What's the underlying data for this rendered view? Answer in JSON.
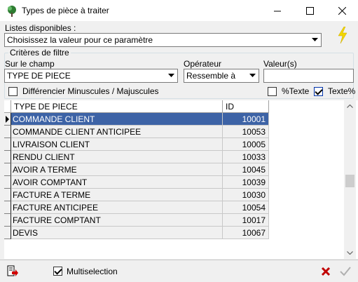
{
  "window": {
    "title": "Types de pièce à traiter"
  },
  "lists": {
    "label": "Listes disponibles :",
    "selected": "Choisissez la valeur pour ce paramètre"
  },
  "filter": {
    "group_title": "Critères de filtre",
    "field_label": "Sur le champ",
    "field_value": "TYPE DE PIECE",
    "operator_label": "Opérateur",
    "operator_value": "Ressemble à",
    "value_label": "Valeur(s)",
    "value": "",
    "case_label": "Différencier Minuscules / Majuscules",
    "case_checked": false,
    "pct_text_label": "%Texte",
    "pct_text_checked": false,
    "text_pct_label": "Texte%",
    "text_pct_checked": true
  },
  "grid": {
    "columns": [
      "TYPE DE PIECE",
      "ID"
    ],
    "rows": [
      {
        "type": "COMMANDE CLIENT",
        "id": "10001"
      },
      {
        "type": "COMMANDE CLIENT ANTICIPEE",
        "id": "10053"
      },
      {
        "type": "LIVRAISON CLIENT",
        "id": "10005"
      },
      {
        "type": "RENDU CLIENT",
        "id": "10033"
      },
      {
        "type": "AVOIR A TERME",
        "id": "10045"
      },
      {
        "type": "AVOIR COMPTANT",
        "id": "10039"
      },
      {
        "type": "FACTURE A TERME",
        "id": "10030"
      },
      {
        "type": "FACTURE ANTICIPEE",
        "id": "10054"
      },
      {
        "type": "FACTURE COMPTANT",
        "id": "10017"
      },
      {
        "type": "DEVIS",
        "id": "10067"
      }
    ],
    "selected_index": 0
  },
  "bottom": {
    "multiselection_label": "Multiselection",
    "multiselection_checked": true
  },
  "colors": {
    "selection": "#3d63a6",
    "lightning": "#f2d600",
    "cancel": "#c00000"
  },
  "icons": {
    "app": "app-tree-icon",
    "lightning": "lightning-icon",
    "export": "export-icon",
    "cancel": "cancel-x-icon",
    "validate": "check-icon"
  }
}
